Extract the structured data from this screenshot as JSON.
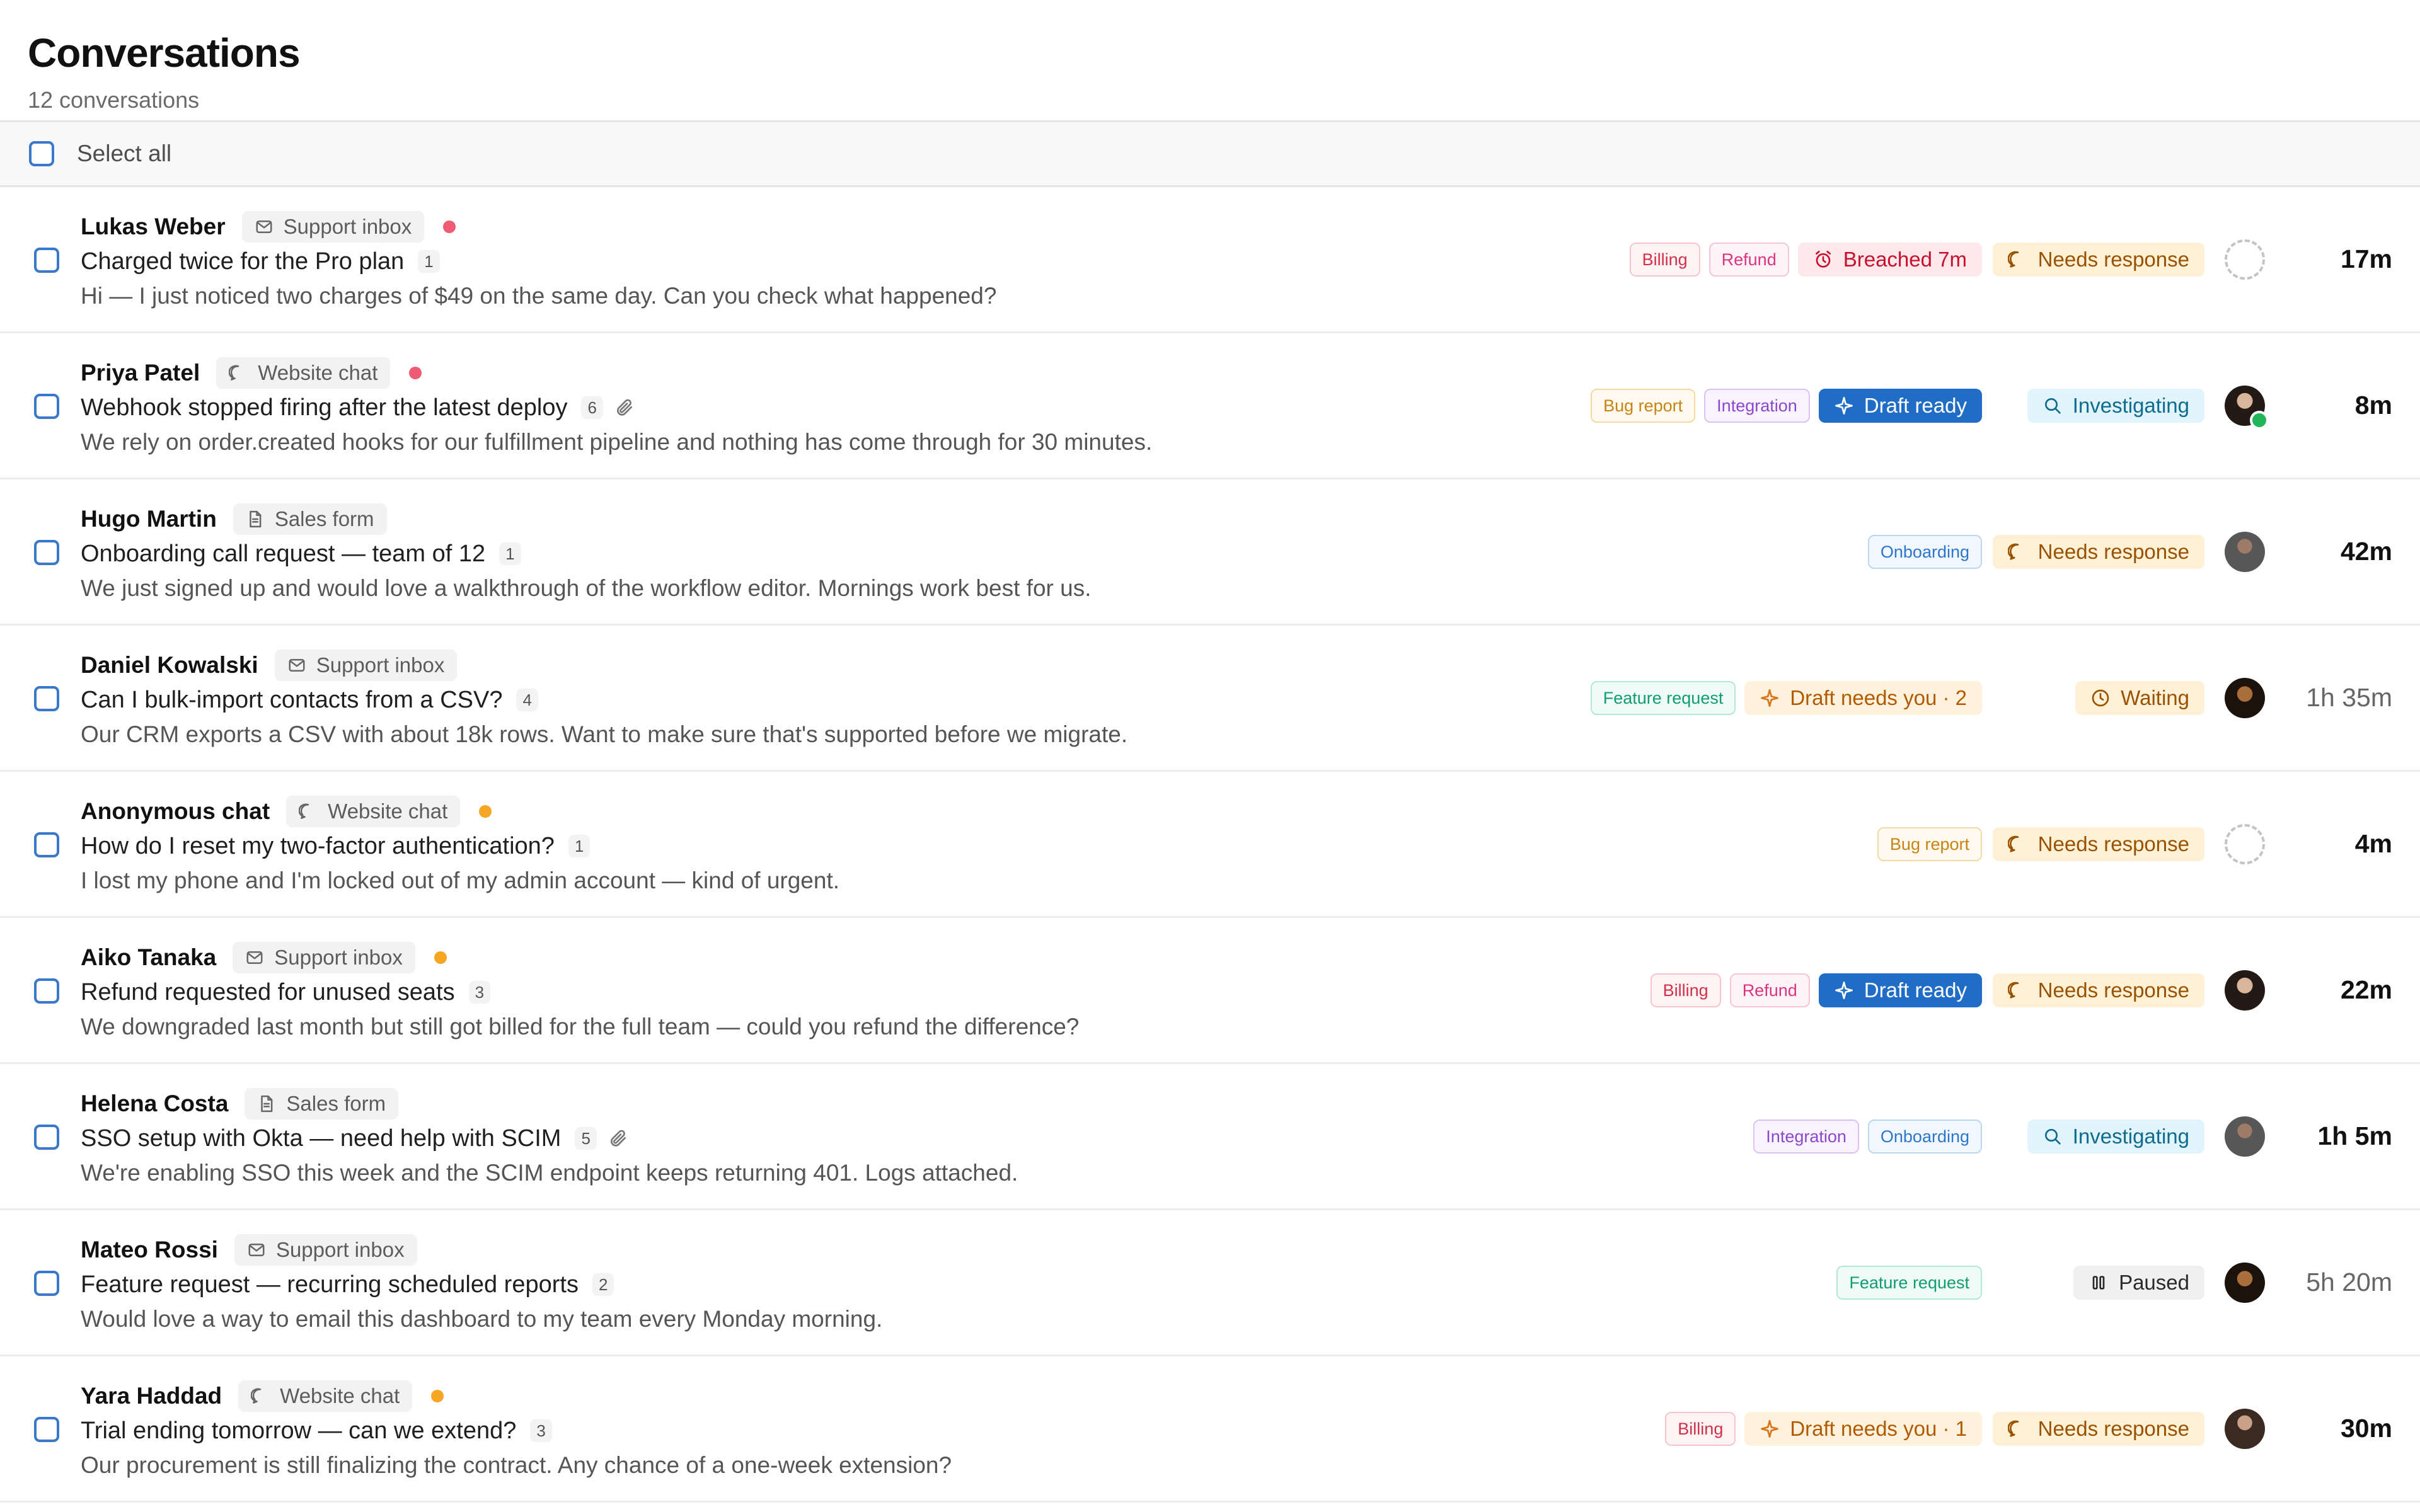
{
  "page": {
    "title": "Conversations",
    "subtitle": "12 conversations"
  },
  "select_all": {
    "label": "Select all"
  },
  "colors": {
    "accent": "#3a78c9",
    "needs_response_bg": "#fef1d6",
    "investigating_bg": "#e1f3fb",
    "breached_fg": "#c8102e",
    "draft_ready_bg": "#1f6dc4",
    "unread_dot_red": "#ef5b73",
    "unread_dot_orange": "#f5a623",
    "online": "#22b559"
  },
  "rows": [
    {
      "sender": "Lukas Weber",
      "channel": "Support inbox",
      "channel_icon": "mail-icon",
      "dot": "red",
      "subject": "Charged twice for the Pro plan",
      "count": "1",
      "attachment": false,
      "preview": "Hi — I just noticed two charges of $49 on the same day. Can you check what happened?",
      "tags": [
        "Billing",
        "Refund"
      ],
      "flag": {
        "type": "breached",
        "label": "Breached 7m",
        "icon": "alarm-clock-icon"
      },
      "status": {
        "type": "needs",
        "label": "Needs response",
        "icon": "chat-bubble-icon"
      },
      "assignee": "unassigned",
      "time": "17m",
      "time_bold": true
    },
    {
      "sender": "Priya Patel",
      "channel": "Website chat",
      "channel_icon": "chat-bubble-icon",
      "dot": "red",
      "subject": "Webhook stopped firing after the latest deploy",
      "count": "6",
      "attachment": true,
      "preview": "We rely on order.created hooks for our fulfillment pipeline and nothing has come through for 30 minutes.",
      "tags": [
        "Bug report",
        "Integration"
      ],
      "flag": {
        "type": "draft-ready",
        "label": "Draft ready",
        "icon": "sparkle-icon"
      },
      "status": {
        "type": "invest",
        "label": "Investigating",
        "icon": "magnifier-icon"
      },
      "assignee": "avatar-online",
      "time": "8m",
      "time_bold": true
    },
    {
      "sender": "Hugo Martin",
      "channel": "Sales form",
      "channel_icon": "document-icon",
      "dot": "none",
      "subject": "Onboarding call request — team of 12",
      "count": "1",
      "attachment": false,
      "preview": "We just signed up and would love a walkthrough of the workflow editor. Mornings work best for us.",
      "tags": [
        "Onboarding"
      ],
      "flag": null,
      "status": {
        "type": "needs",
        "label": "Needs response",
        "icon": "chat-bubble-icon"
      },
      "assignee": "avatar",
      "time": "42m",
      "time_bold": true
    },
    {
      "sender": "Daniel Kowalski",
      "channel": "Support inbox",
      "channel_icon": "mail-icon",
      "dot": "none",
      "subject": "Can I bulk-import contacts from a CSV?",
      "count": "4",
      "attachment": false,
      "preview": "Our CRM exports a CSV with about 18k rows. Want to make sure that's supported before we migrate.",
      "tags": [
        "Feature request"
      ],
      "flag": {
        "type": "draft-needs",
        "label": "Draft needs you · 2",
        "icon": "sparkle-icon"
      },
      "status": {
        "type": "waiting",
        "label": "Waiting",
        "icon": "clock-icon"
      },
      "assignee": "avatar",
      "time": "1h 35m",
      "time_bold": false
    },
    {
      "sender": "Anonymous chat",
      "channel": "Website chat",
      "channel_icon": "chat-bubble-icon",
      "dot": "orange",
      "subject": "How do I reset my two-factor authentication?",
      "count": "1",
      "attachment": false,
      "preview": "I lost my phone and I'm locked out of my admin account — kind of urgent.",
      "tags": [
        "Bug report"
      ],
      "flag": null,
      "status": {
        "type": "needs",
        "label": "Needs response",
        "icon": "chat-bubble-icon"
      },
      "assignee": "unassigned",
      "time": "4m",
      "time_bold": true
    },
    {
      "sender": "Aiko Tanaka",
      "channel": "Support inbox",
      "channel_icon": "mail-icon",
      "dot": "orange",
      "subject": "Refund requested for unused seats",
      "count": "3",
      "attachment": false,
      "preview": "We downgraded last month but still got billed for the full team — could you refund the difference?",
      "tags": [
        "Billing",
        "Refund"
      ],
      "flag": {
        "type": "draft-ready",
        "label": "Draft ready",
        "icon": "sparkle-icon"
      },
      "status": {
        "type": "needs",
        "label": "Needs response",
        "icon": "chat-bubble-icon"
      },
      "assignee": "avatar",
      "time": "22m",
      "time_bold": true
    },
    {
      "sender": "Helena Costa",
      "channel": "Sales form",
      "channel_icon": "document-icon",
      "dot": "none",
      "subject": "SSO setup with Okta — need help with SCIM",
      "count": "5",
      "attachment": true,
      "preview": "We're enabling SSO this week and the SCIM endpoint keeps returning 401. Logs attached.",
      "tags": [
        "Integration",
        "Onboarding"
      ],
      "flag": null,
      "status": {
        "type": "invest",
        "label": "Investigating",
        "icon": "magnifier-icon"
      },
      "assignee": "avatar",
      "time": "1h 5m",
      "time_bold": true
    },
    {
      "sender": "Mateo Rossi",
      "channel": "Support inbox",
      "channel_icon": "mail-icon",
      "dot": "none",
      "subject": "Feature request — recurring scheduled reports",
      "count": "2",
      "attachment": false,
      "preview": "Would love a way to email this dashboard to my team every Monday morning.",
      "tags": [
        "Feature request"
      ],
      "flag": null,
      "status": {
        "type": "paused",
        "label": "Paused",
        "icon": "pause-icon"
      },
      "assignee": "avatar",
      "time": "5h 20m",
      "time_bold": false
    },
    {
      "sender": "Yara Haddad",
      "channel": "Website chat",
      "channel_icon": "chat-bubble-icon",
      "dot": "orange",
      "subject": "Trial ending tomorrow — can we extend?",
      "count": "3",
      "attachment": false,
      "preview": "Our procurement is still finalizing the contract. Any chance of a one-week extension?",
      "tags": [
        "Billing"
      ],
      "flag": {
        "type": "draft-needs",
        "label": "Draft needs you · 1",
        "icon": "sparkle-icon"
      },
      "status": {
        "type": "needs",
        "label": "Needs response",
        "icon": "chat-bubble-icon"
      },
      "assignee": "avatar",
      "time": "30m",
      "time_bold": true
    }
  ]
}
